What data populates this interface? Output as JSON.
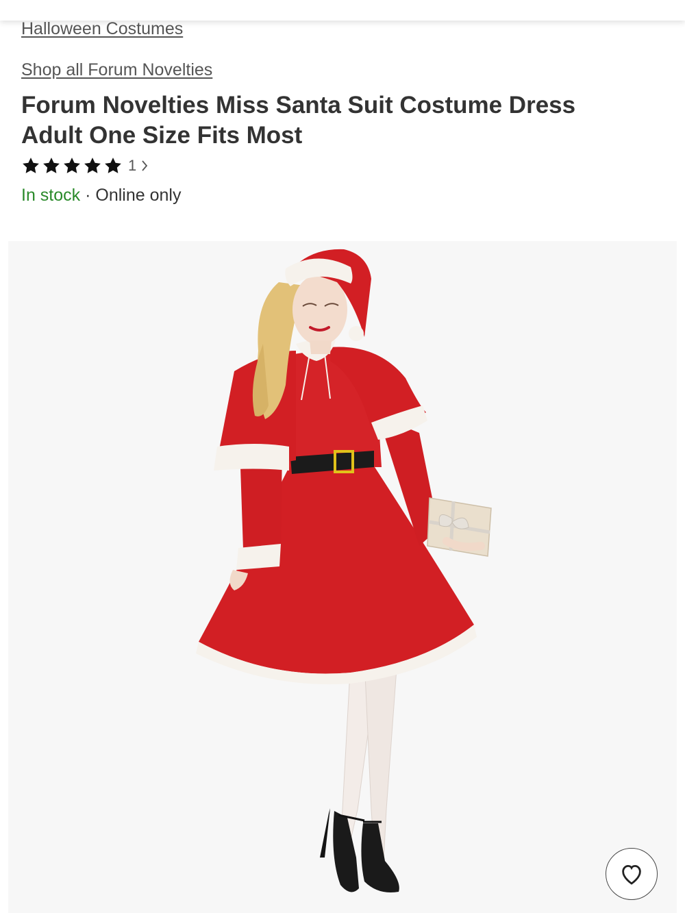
{
  "breadcrumb": {
    "category": "Halloween Costumes"
  },
  "brand_link": "Shop all Forum Novelties",
  "product": {
    "title": "Forum Novelties Miss Santa Suit Costume Dress Adult One Size Fits Most",
    "rating_stars": 5,
    "rating_max": 5,
    "review_count": "1",
    "stock_status": "In stock",
    "separator": "·",
    "availability": "Online only"
  },
  "icons": {
    "rating": "star-icon",
    "reviews_link": "chevron-right-icon",
    "favorite": "heart-icon"
  },
  "colors": {
    "in_stock": "#2a8a2a",
    "text": "#333333",
    "link": "#555555",
    "dress_red": "#d21f24"
  }
}
